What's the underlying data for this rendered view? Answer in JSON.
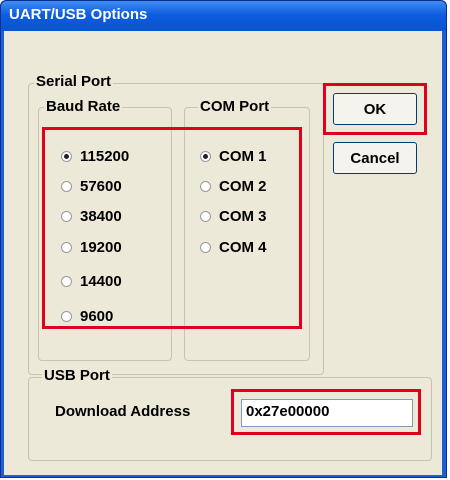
{
  "window": {
    "title": "UART/USB Options"
  },
  "serial_port": {
    "label": "Serial Port",
    "baud_rate": {
      "label": "Baud Rate",
      "options": [
        "115200",
        "57600",
        "38400",
        "19200",
        "14400",
        "9600"
      ],
      "selected": "115200"
    },
    "com_port": {
      "label": "COM Port",
      "options": [
        "COM 1",
        "COM 2",
        "COM 3",
        "COM 4"
      ],
      "selected": "COM 1"
    }
  },
  "buttons": {
    "ok": "OK",
    "cancel": "Cancel"
  },
  "usb_port": {
    "label": "USB Port",
    "download_address_label": "Download Address",
    "download_address_value": "0x27e00000"
  },
  "colors": {
    "highlight": "#e0001b",
    "titlebar": "#0852d0",
    "dialog_bg": "#ece9d8"
  }
}
